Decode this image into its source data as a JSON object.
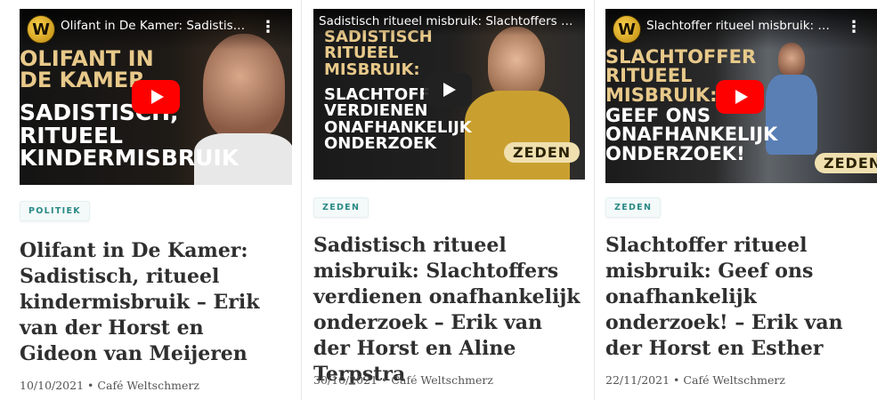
{
  "cards": [
    {
      "video_title": "Olifant in De Kamer: Sadistisc...",
      "thumb_text_lines": [
        "Olifant in",
        "De Kamer",
        "Sadistisch,",
        "ritueel",
        "kindermisbruik"
      ],
      "category": "POLITIEK",
      "title": "Olifant in De Kamer: Sadistisch, ritueel kindermisbruik – Erik van der Horst en Gideon van Meijeren",
      "date": "10/10/2021",
      "author": "Café Weltschmerz"
    },
    {
      "video_title": "Sadistisch ritueel misbruik: Slachtoffers ver...",
      "thumb_text_lines": [
        "Sadistisch",
        "ritueel",
        "misbruik:",
        "Slachtoff",
        "verdienen",
        "onafhankelijk",
        "onderzoek"
      ],
      "badge": "ZEDEN",
      "category": "ZEDEN",
      "title": "Sadistisch ritueel misbruik: Slachtoffers verdienen onafhankelijk onderzoek – Erik van der Horst en Aline Terpstra",
      "date": "30/10/2021",
      "author": "Café Weltschmerz"
    },
    {
      "video_title": "Slachtoffer ritueel misbruik: G...",
      "thumb_text_lines": [
        "Slachtoffer",
        "ritueel",
        "misbruik:",
        "Geef ons",
        "onafhankelijk",
        "onderzoek!"
      ],
      "badge": "ZEDEN",
      "category": "ZEDEN",
      "title": "Slachtoffer ritueel misbruik: Geef ons onafhankelijk onderzoek! – Erik van der Horst en Esther",
      "date": "22/11/2021",
      "author": "Café Weltschmerz"
    }
  ],
  "colors": {
    "accent": "#2a8a86",
    "youtube_red": "#ff0000",
    "thumb_text_gold": "#e8c98a"
  },
  "icons": [
    "channel-logo-icon",
    "more-options-icon",
    "play-icon"
  ]
}
